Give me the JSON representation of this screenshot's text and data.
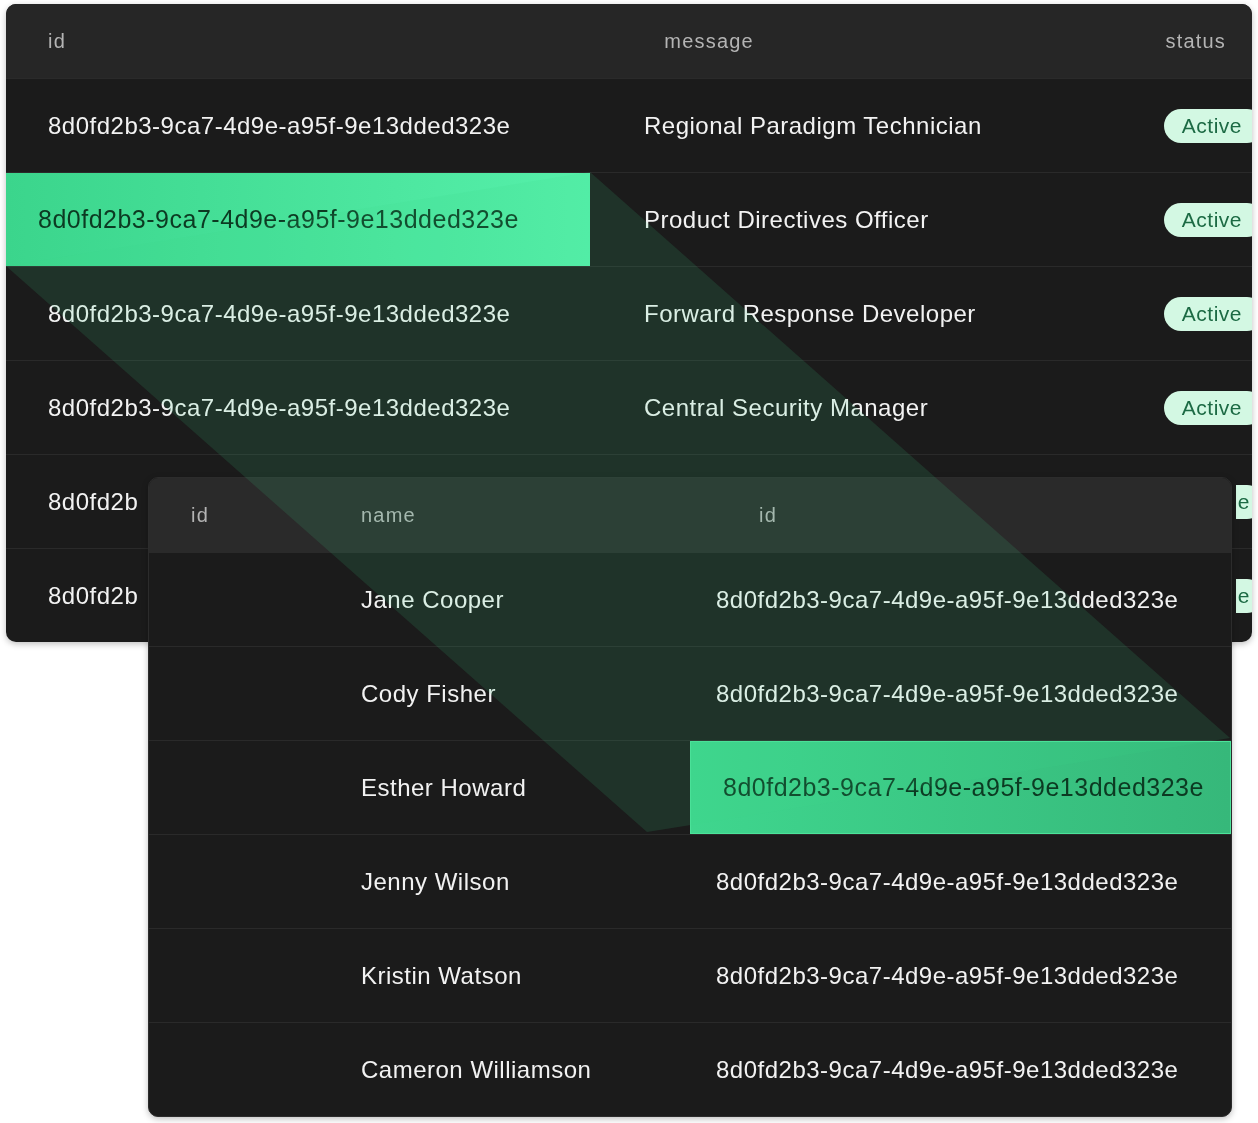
{
  "back_table": {
    "columns": [
      "id",
      "message",
      "status"
    ],
    "rows": [
      {
        "kind": "full",
        "id": "8d0fd2b3-9ca7-4d9e-a95f-9e13dded323e",
        "message": "Regional Paradigm Technician",
        "status": "Active",
        "selected": false
      },
      {
        "kind": "full",
        "id": "8d0fd2b3-9ca7-4d9e-a95f-9e13dded323e",
        "message": "Product Directives Officer",
        "status": "Active",
        "selected": true
      },
      {
        "kind": "full",
        "id": "8d0fd2b3-9ca7-4d9e-a95f-9e13dded323e",
        "message": "Forward Response Developer",
        "status": "Active",
        "selected": false
      },
      {
        "kind": "full",
        "id": "8d0fd2b3-9ca7-4d9e-a95f-9e13dded323e",
        "message": "Central Security Manager",
        "status": "Active",
        "selected": false
      },
      {
        "kind": "covered",
        "id": "8d0fd2b",
        "status": "e",
        "selected": false
      },
      {
        "kind": "covered",
        "id": "8d0fd2b",
        "status": "e",
        "selected": false
      }
    ]
  },
  "front_table": {
    "columns": [
      "id",
      "name",
      "id"
    ],
    "rows": [
      {
        "name": "Jane Cooper",
        "id": "8d0fd2b3-9ca7-4d9e-a95f-9e13dded323e",
        "selected": false
      },
      {
        "name": "Cody Fisher",
        "id": "8d0fd2b3-9ca7-4d9e-a95f-9e13dded323e",
        "selected": false
      },
      {
        "name": "Esther Howard",
        "id": "8d0fd2b3-9ca7-4d9e-a95f-9e13dded323e",
        "selected": true
      },
      {
        "name": "Jenny Wilson",
        "id": "8d0fd2b3-9ca7-4d9e-a95f-9e13dded323e",
        "selected": false
      },
      {
        "name": "Kristin Watson",
        "id": "8d0fd2b3-9ca7-4d9e-a95f-9e13dded323e",
        "selected": false
      },
      {
        "name": "Cameron Williamson",
        "id": "8d0fd2b3-9ca7-4d9e-a95f-9e13dded323e",
        "selected": false
      }
    ]
  }
}
